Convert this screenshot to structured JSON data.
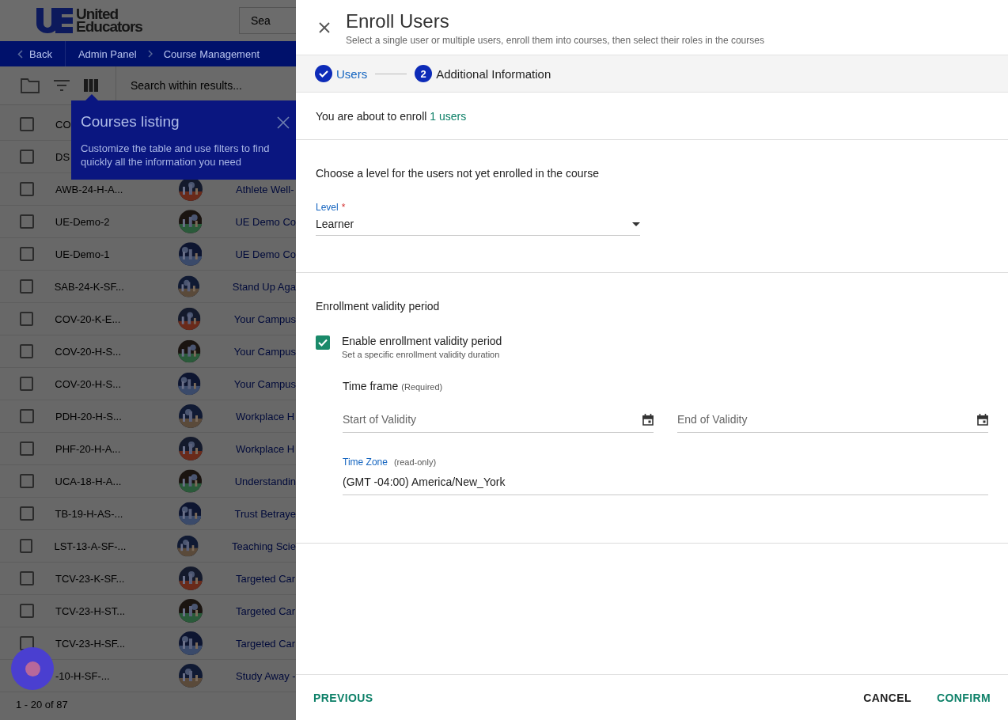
{
  "header": {
    "logo_line1": "United",
    "logo_line2": "Educators",
    "search_placeholder": "Sea"
  },
  "breadcrumb": {
    "back": "Back",
    "items": [
      "Admin Panel",
      "Course Management"
    ]
  },
  "toolbar": {
    "search_placeholder": "Search within results..."
  },
  "tooltip": {
    "title": "Courses listing",
    "text": "Customize the table and use filters to find quickly all the information you need"
  },
  "rows": [
    {
      "code": "CO",
      "checked": false
    },
    {
      "code": "DS",
      "checked": false
    },
    {
      "code": "AWB-24-H-A...",
      "title": "Athlete Well-",
      "checked": false
    },
    {
      "code": "UE-Demo-2",
      "title": "UE Demo Co",
      "checked": false
    },
    {
      "code": "UE-Demo-1",
      "title": "UE Demo Co",
      "checked": false
    },
    {
      "code": "SAB-24-K-SF...",
      "title": "Stand Up Aga",
      "checked": false
    },
    {
      "code": "COV-20-K-E...",
      "title": "Your Campus",
      "checked": false
    },
    {
      "code": "COV-20-H-S...",
      "title": "Your Campus",
      "checked": false
    },
    {
      "code": "COV-20-H-S...",
      "title": "Your Campus",
      "checked": false
    },
    {
      "code": "PDH-20-H-S...",
      "title": "Workplace H",
      "checked": false
    },
    {
      "code": "PHF-20-H-A...",
      "title": "Workplace H",
      "checked": false
    },
    {
      "code": "UCA-18-H-A...",
      "title": "Understandin",
      "checked": false
    },
    {
      "code": "TB-19-H-AS-...",
      "title": "Trust Betraye",
      "checked": false
    },
    {
      "code": "LST-13-A-SF-...",
      "title": "Teaching Scie",
      "checked": false
    },
    {
      "code": "TCV-23-K-SF...",
      "title": "Targeted Car",
      "checked": false
    },
    {
      "code": "TCV-23-H-ST...",
      "title": "Targeted Car",
      "checked": false
    },
    {
      "code": "TCV-23-H-SF...",
      "title": "Targeted Car",
      "checked": false
    },
    {
      "code": "-10-H-SF-...",
      "title": "Study Away -"
    }
  ],
  "pagination": "1 - 20 of 87",
  "dialog": {
    "title": "Enroll Users",
    "subtitle": "Select a single user or multiple users, enroll them into courses, then select their roles in the courses",
    "steps": [
      {
        "label": "Users",
        "done": true
      },
      {
        "label": "Additional Information",
        "number": "2",
        "done": false
      }
    ],
    "summary": {
      "text": "You are about to enroll",
      "count": "1 users"
    },
    "level_section": {
      "heading": "Choose a level for the users not yet enrolled in the course",
      "label": "Level",
      "required_mark": "*",
      "value": "Learner"
    },
    "validity": {
      "heading": "Enrollment validity period",
      "checkbox_label": "Enable enrollment validity period",
      "checkbox_hint": "Set a specific enrollment validity duration",
      "checked": true,
      "time_frame": "Time frame",
      "time_frame_note": "(Required)",
      "start_placeholder": "Start of Validity",
      "end_placeholder": "End of Validity",
      "time_zone_label": "Time Zone",
      "time_zone_note": "(read-only)",
      "time_zone_value": "(GMT -04:00) America/New_York"
    },
    "footer": {
      "previous": "PREVIOUS",
      "cancel": "CANCEL",
      "confirm": "CONFIRM"
    }
  }
}
